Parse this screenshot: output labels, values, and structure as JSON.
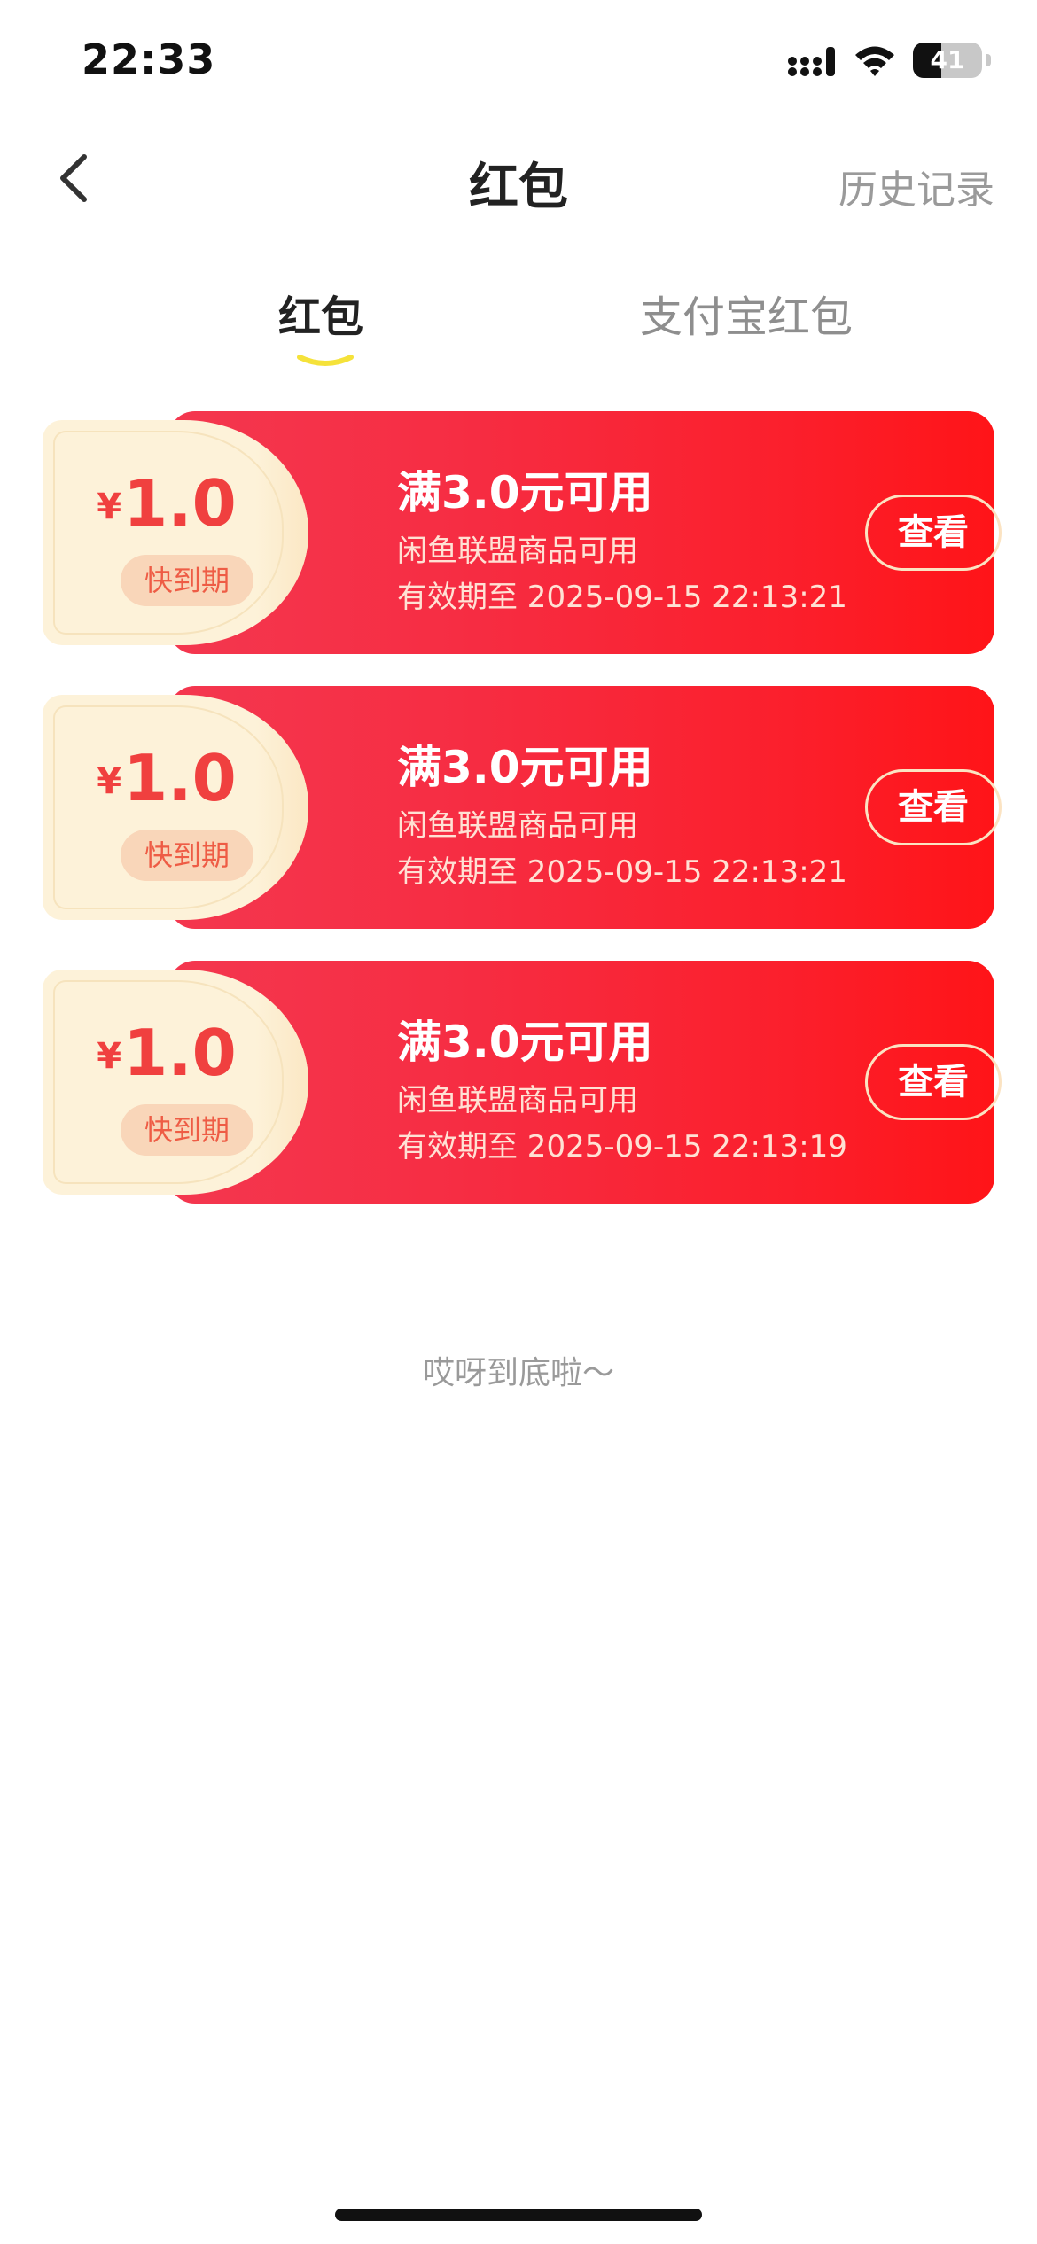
{
  "status_bar": {
    "time": "22:33",
    "battery": "41",
    "battery_level_percent": 41,
    "icons": [
      "signal-icon",
      "wifi-icon",
      "battery-icon"
    ]
  },
  "nav": {
    "back_icon": "chevron-left-icon",
    "title": "红包",
    "history": "历史记录"
  },
  "tabs": {
    "active": "红包",
    "inactive": "支付宝红包",
    "accent_color": "#f5e23a"
  },
  "coupons": [
    {
      "currency": "¥",
      "amount": "1.0",
      "badge": "快到期",
      "title": "满3.0元可用",
      "scope": "闲鱼联盟商品可用",
      "validity": "有效期至 2025-09-15 22:13:21",
      "button": "查看"
    },
    {
      "currency": "¥",
      "amount": "1.0",
      "badge": "快到期",
      "title": "满3.0元可用",
      "scope": "闲鱼联盟商品可用",
      "validity": "有效期至 2025-09-15 22:13:21",
      "button": "查看"
    },
    {
      "currency": "¥",
      "amount": "1.0",
      "badge": "快到期",
      "title": "满3.0元可用",
      "scope": "闲鱼联盟商品可用",
      "validity": "有效期至 2025-09-15 22:13:19",
      "button": "查看"
    }
  ],
  "footer": {
    "end_text": "哎呀到底啦～"
  },
  "colors": {
    "coupon_red": "#f62d43",
    "coupon_cream": "#fdf2d9",
    "amount_red": "#f0403f"
  }
}
